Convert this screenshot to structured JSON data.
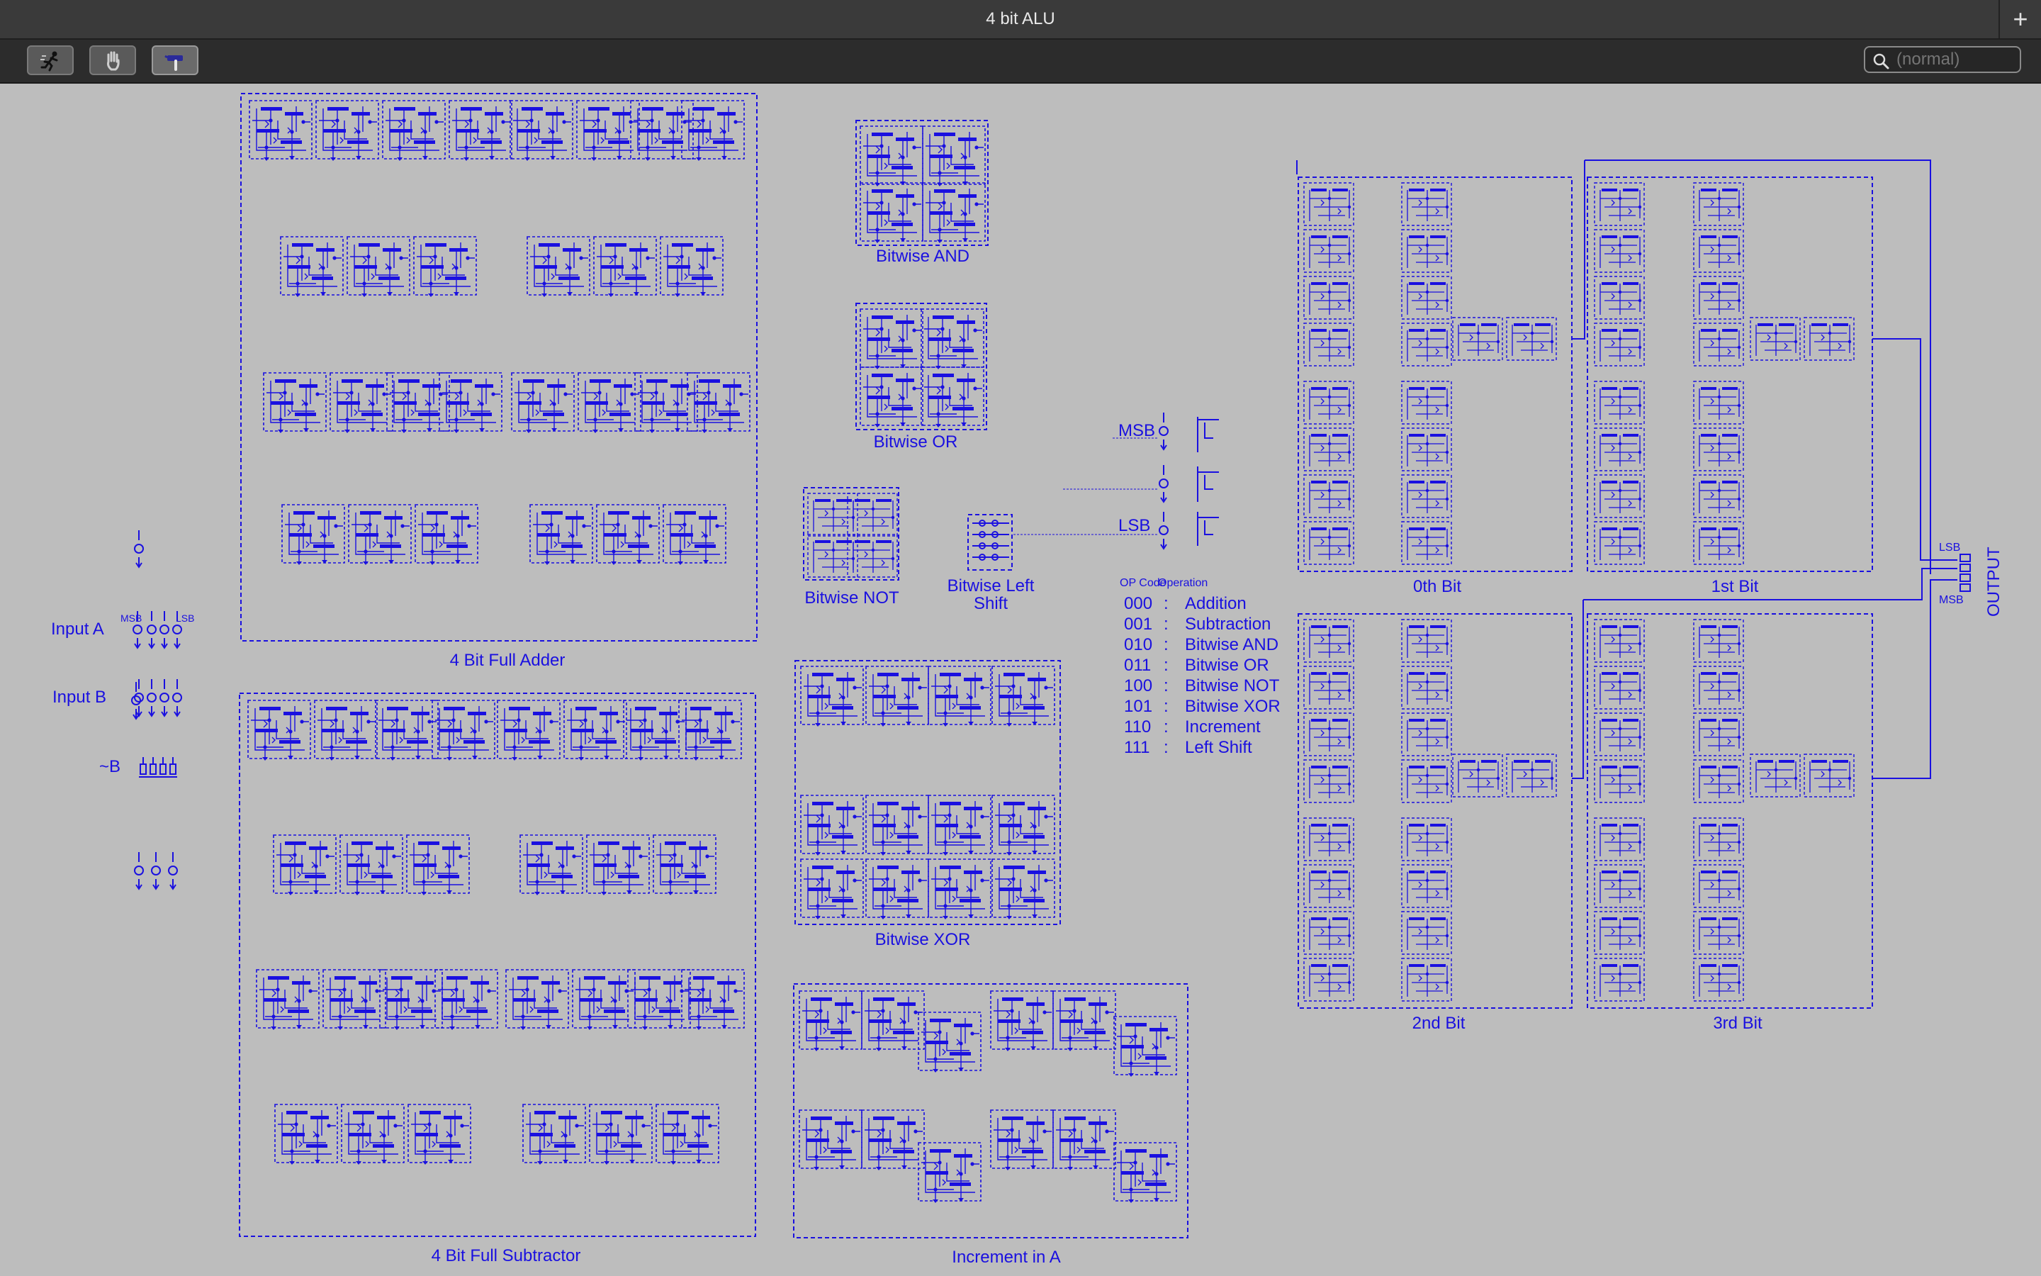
{
  "window": {
    "title": "4 bit ALU",
    "add_tab_icon": "plus-icon"
  },
  "toolbar": {
    "tools": [
      {
        "name": "run-tool",
        "icon": "running-person-icon",
        "active": false
      },
      {
        "name": "hand-tool",
        "icon": "hand-icon",
        "active": false
      },
      {
        "name": "build-tool",
        "icon": "hammer-icon",
        "active": true
      }
    ],
    "search": {
      "placeholder": "(normal)",
      "icon": "magnifier-icon"
    }
  },
  "colors": {
    "wire": "#1a10e0",
    "canvas": "#bdbdbd",
    "titlebar": "#3a3a3a",
    "toolbar": "#2c2c2c"
  },
  "inputs": {
    "input_a": "Input A",
    "input_b": "Input B",
    "not_b": "~B",
    "msb": "MSB",
    "lsb": "LSB"
  },
  "modules": {
    "full_adder": "4 Bit Full Adder",
    "full_subtractor": "4 Bit Full Subtractor",
    "bitwise_and": "Bitwise AND",
    "bitwise_or": "Bitwise OR",
    "bitwise_not": "Bitwise NOT",
    "left_shift": "Bitwise Left\nShift",
    "bitwise_xor": "Bitwise XOR",
    "increment": "Increment in A",
    "mux_bit0": "0th Bit",
    "mux_bit1": "1st Bit",
    "mux_bit2": "2nd Bit",
    "mux_bit3": "3rd Bit"
  },
  "opcode_selector": {
    "msb": "MSB",
    "lsb": "LSB"
  },
  "op_table": {
    "header_code": "OP Code",
    "header_operation": "Operation",
    "separator": ":",
    "rows": [
      {
        "code": "000",
        "operation": "Addition"
      },
      {
        "code": "001",
        "operation": "Subtraction"
      },
      {
        "code": "010",
        "operation": "Bitwise AND"
      },
      {
        "code": "011",
        "operation": "Bitwise OR"
      },
      {
        "code": "100",
        "operation": "Bitwise NOT"
      },
      {
        "code": "101",
        "operation": "Bitwise XOR"
      },
      {
        "code": "110",
        "operation": "Increment"
      },
      {
        "code": "111",
        "operation": "Left Shift"
      }
    ]
  },
  "output": {
    "label": "OUTPUT",
    "lsb": "LSB",
    "msb": "MSB"
  }
}
